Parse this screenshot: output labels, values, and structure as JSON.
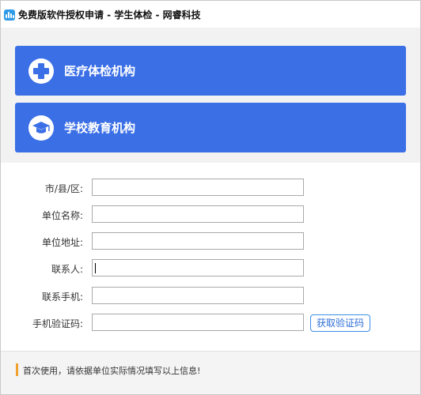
{
  "window": {
    "title": "免费版软件授权申请 - 学生体检 - 网睿科技",
    "icon": "app-waveform-icon"
  },
  "cards": [
    {
      "label": "医疗体检机构",
      "icon": "medical-cross-icon"
    },
    {
      "label": "学校教育机构",
      "icon": "graduation-cap-icon"
    }
  ],
  "form": {
    "city_label": "市/县/区:",
    "org_name_label": "单位名称:",
    "org_address_label": "单位地址:",
    "contact_label": "联系人:",
    "mobile_label": "联系手机:",
    "code_label": "手机验证码:",
    "city_value": "",
    "org_name_value": "",
    "org_address_value": "",
    "contact_value": "",
    "mobile_value": "",
    "code_value": "",
    "get_code_button": "获取验证码"
  },
  "footer": {
    "message": "首次使用，请依据单位实际情况填写以上信息!"
  },
  "colors": {
    "card_blue": "#3b6fe6",
    "accent_orange": "#f0a02c",
    "link_blue": "#2f6fd8"
  }
}
